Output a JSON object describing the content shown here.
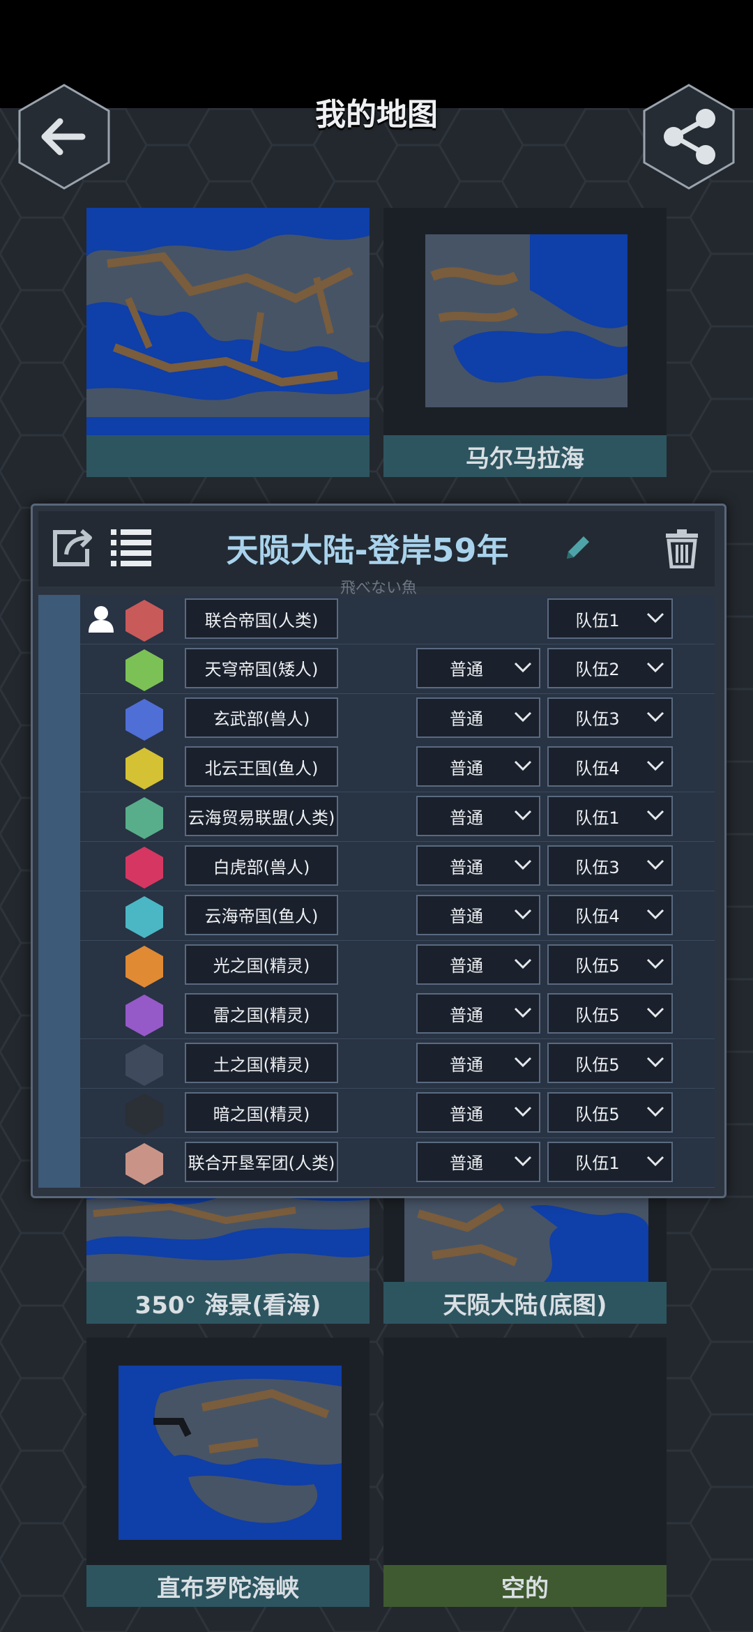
{
  "page_title": "我的地图",
  "colors": {
    "background": "#23282e",
    "card_label": "#2d5560",
    "empty_label": "#3f5a30",
    "dialog_title": "#a9d3ec",
    "water": "#0f3fa8",
    "land": "#475466",
    "dirt": "#7a5d3c"
  },
  "cards": [
    {
      "label": ""
    },
    {
      "label": "马尔马拉海"
    },
    {
      "label": "350° 海景(看海)"
    },
    {
      "label": "天陨大陆(底图)"
    },
    {
      "label": "直布罗陀海峡"
    },
    {
      "label": "空的"
    }
  ],
  "dialog": {
    "title": "天陨大陆-登岸59年",
    "author": "飛べない魚",
    "icons": [
      "export-icon",
      "list-icon",
      "pencil-icon",
      "trash-icon"
    ],
    "players": [
      {
        "name": "联合帝国(人类)",
        "color": "#c95a5a",
        "human": true,
        "difficulty": "",
        "team": "队伍1"
      },
      {
        "name": "天穹帝国(矮人)",
        "color": "#7cc156",
        "human": false,
        "difficulty": "普通",
        "team": "队伍2"
      },
      {
        "name": "玄武部(兽人)",
        "color": "#4f6fd6",
        "human": false,
        "difficulty": "普通",
        "team": "队伍3"
      },
      {
        "name": "北云王国(鱼人)",
        "color": "#d4c134",
        "human": false,
        "difficulty": "普通",
        "team": "队伍4"
      },
      {
        "name": "云海贸易联盟(人类)",
        "color": "#58ae8a",
        "human": false,
        "difficulty": "普通",
        "team": "队伍1"
      },
      {
        "name": "白虎部(兽人)",
        "color": "#d63762",
        "human": false,
        "difficulty": "普通",
        "team": "队伍3"
      },
      {
        "name": "云海帝国(鱼人)",
        "color": "#4bb7c4",
        "human": false,
        "difficulty": "普通",
        "team": "队伍4"
      },
      {
        "name": "光之国(精灵)",
        "color": "#e08a33",
        "human": false,
        "difficulty": "普通",
        "team": "队伍5"
      },
      {
        "name": "雷之国(精灵)",
        "color": "#9659c8",
        "human": false,
        "difficulty": "普通",
        "team": "队伍5"
      },
      {
        "name": "土之国(精灵)",
        "color": "#3f4a5c",
        "human": false,
        "difficulty": "普通",
        "team": "队伍5"
      },
      {
        "name": "暗之国(精灵)",
        "color": "#2b2f36",
        "human": false,
        "difficulty": "普通",
        "team": "队伍5"
      },
      {
        "name": "联合开垦军团(人类)",
        "color": "#c99487",
        "human": false,
        "difficulty": "普通",
        "team": "队伍1"
      }
    ]
  }
}
